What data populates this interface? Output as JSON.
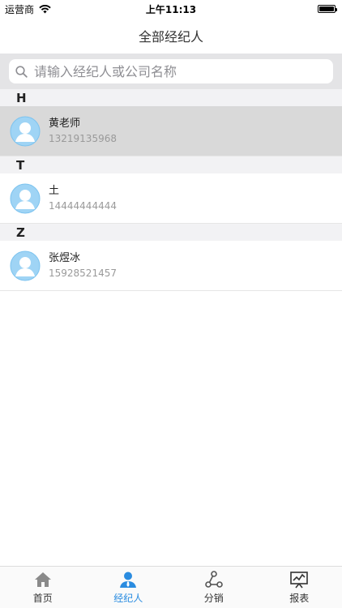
{
  "status_bar": {
    "carrier": "运营商",
    "time": "上午11:13"
  },
  "header": {
    "title": "全部经纪人"
  },
  "search": {
    "placeholder": "请输入经纪人或公司名称"
  },
  "sections": [
    {
      "letter": "H",
      "items": [
        {
          "name": "黄老师",
          "phone": "13219135968",
          "selected": true
        }
      ]
    },
    {
      "letter": "T",
      "items": [
        {
          "name": "土",
          "phone": "14444444444",
          "selected": false
        }
      ]
    },
    {
      "letter": "Z",
      "items": [
        {
          "name": "张煜冰",
          "phone": "15928521457",
          "selected": false
        }
      ]
    }
  ],
  "tabbar": {
    "items": [
      {
        "label": "首页",
        "icon": "home-icon",
        "active": false
      },
      {
        "label": "经纪人",
        "icon": "person-icon",
        "active": true
      },
      {
        "label": "分销",
        "icon": "share-icon",
        "active": false
      },
      {
        "label": "报表",
        "icon": "chart-icon",
        "active": false
      }
    ]
  },
  "colors": {
    "accent": "#2a8ce0",
    "selected_row": "#d9d9d9",
    "section_header": "#f2f2f4",
    "search_bg": "#e4e4e6",
    "avatar": "#9fd4f5"
  }
}
